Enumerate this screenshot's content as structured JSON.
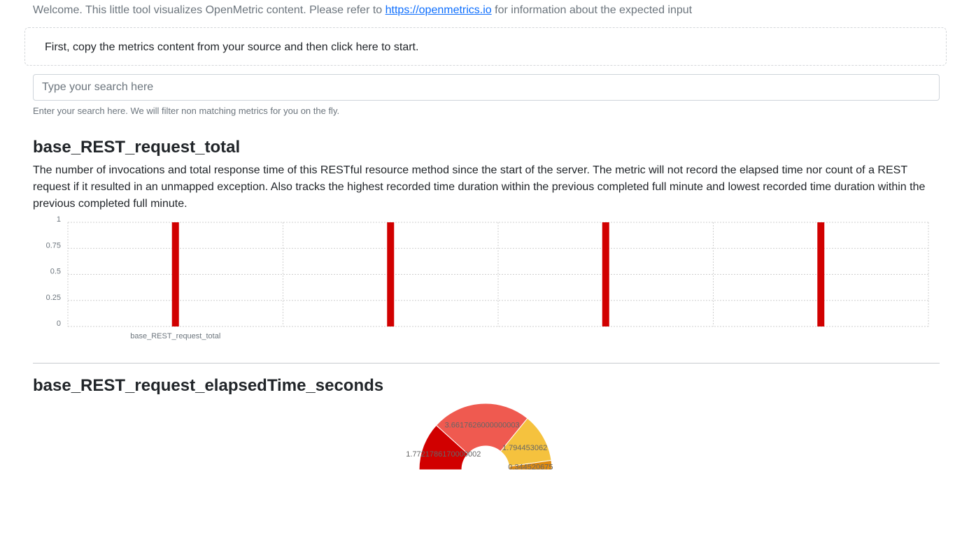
{
  "intro": {
    "text_before": "Welcome. This little tool visualizes OpenMetric content. Please refer to ",
    "link_text": "https://openmetrics.io",
    "text_after": " for information about the expected input"
  },
  "start_prompt": "First, copy the metrics content from your source and then click here to start.",
  "search": {
    "placeholder": "Type your search here",
    "value": "",
    "help": "Enter your search here. We will filter non matching metrics for you on the fly."
  },
  "metrics": [
    {
      "name": "base_REST_request_total",
      "description": "The number of invocations and total response time of this RESTful resource method since the start of the server. The metric will not record the elapsed time nor count of a REST request if it resulted in an unmapped exception. Also tracks the highest recorded time duration within the previous completed full minute and lowest recorded time duration within the previous completed full minute."
    },
    {
      "name": "base_REST_request_elapsedTime_seconds",
      "description": ""
    }
  ],
  "chart_data": [
    {
      "type": "bar",
      "categories": [
        "base_REST_request_total",
        "",
        "",
        ""
      ],
      "values": [
        1,
        1,
        1,
        1
      ],
      "ylim": [
        0,
        1
      ],
      "yticks": [
        "1",
        "0.75",
        "0.5",
        "0.25",
        "0"
      ],
      "grid": true,
      "color": "#d10000"
    },
    {
      "type": "pie",
      "variant": "half-doughnut",
      "slices": [
        {
          "label": "1.7721786170000002",
          "value": 1.7721786170000002,
          "color": "#d10000"
        },
        {
          "label": "3.6617626000000003",
          "value": 3.6617626000000003,
          "color": "#ef5a50"
        },
        {
          "label": "1.794453062",
          "value": 1.794453062,
          "color": "#f5c23e"
        },
        {
          "label": "0.344520675",
          "value": 0.344520675,
          "color": "#df8a10"
        }
      ]
    }
  ]
}
